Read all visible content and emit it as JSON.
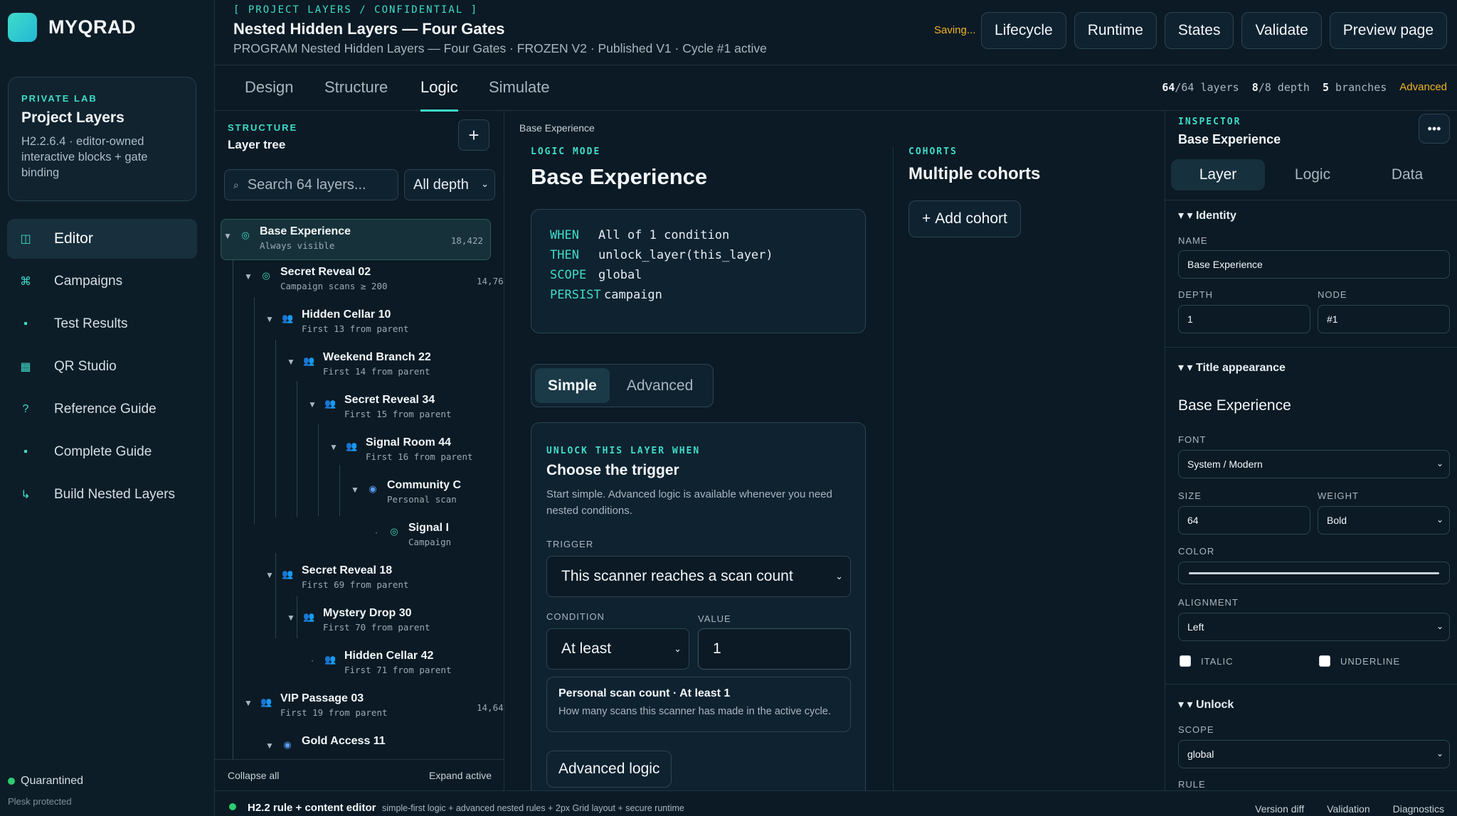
{
  "brand": {
    "name": "MYQRAD"
  },
  "lab": {
    "kicker": "PRIVATE LAB",
    "title": "Project Layers",
    "desc": "H2.2.6.4 · editor-owned interactive blocks + gate binding"
  },
  "nav": [
    {
      "label": "Editor",
      "icon": "layout-icon",
      "glyph": "◫"
    },
    {
      "label": "Campaigns",
      "icon": "command-icon",
      "glyph": "⌘"
    },
    {
      "label": "Test Results",
      "icon": "chart-icon",
      "glyph": "▪"
    },
    {
      "label": "QR Studio",
      "icon": "qr-icon",
      "glyph": "▦"
    },
    {
      "label": "Reference Guide",
      "icon": "help-icon",
      "glyph": "?"
    },
    {
      "label": "Complete Guide",
      "icon": "book-icon",
      "glyph": "▪"
    },
    {
      "label": "Build Nested Layers",
      "icon": "return-arrow-icon",
      "glyph": "↳"
    }
  ],
  "status": {
    "label": "Quarantined",
    "sub": "Plesk protected"
  },
  "header": {
    "kicker": "[ PROJECT LAYERS / CONFIDENTIAL ]",
    "title": "Nested Hidden Layers — Four Gates",
    "subtitle": "PROGRAM Nested Hidden Layers — Four Gates · FROZEN V2 · Published V1 · Cycle #1 active",
    "saving": "Saving...",
    "buttons": [
      "Lifecycle",
      "Runtime",
      "States",
      "Validate",
      "Preview page"
    ]
  },
  "tabs": [
    "Design",
    "Structure",
    "Logic",
    "Simulate"
  ],
  "stats": {
    "layers_a": "64",
    "layers_b": "/64 layers",
    "depth_a": "8",
    "depth_b": "/8 depth",
    "branches_a": "5",
    "branches_b": " branches",
    "mode": "Advanced"
  },
  "tree": {
    "kicker": "STRUCTURE",
    "title": "Layer tree",
    "add": "+",
    "search_placeholder": "Search 64 layers...",
    "depth_filter": "All depth",
    "nodes": [
      {
        "name": "Base Experience",
        "sub": "Always visible",
        "count": "18,422",
        "icon": "target-icon",
        "glyph": "◎",
        "color": "n-teal"
      },
      {
        "name": "Secret Reveal 02",
        "sub": "Campaign scans ≥ 200",
        "count": "14,76",
        "icon": "target-icon",
        "glyph": "◎",
        "color": "n-teal"
      },
      {
        "name": "Hidden Cellar 10",
        "sub": "First 13 from parent",
        "count": "",
        "icon": "users-icon",
        "glyph": "👥",
        "color": "n-grey"
      },
      {
        "name": "Weekend Branch 22",
        "sub": "First 14 from parent",
        "count": "",
        "icon": "users-icon",
        "glyph": "👥",
        "color": "n-grey"
      },
      {
        "name": "Secret Reveal 34",
        "sub": "First 15 from parent",
        "count": "",
        "icon": "users-icon",
        "glyph": "👥",
        "color": "n-grey"
      },
      {
        "name": "Signal Room 44",
        "sub": "First 16 from parent",
        "count": "",
        "icon": "users-icon",
        "glyph": "👥",
        "color": "n-grey"
      },
      {
        "name": "Community C",
        "sub": "Personal scan",
        "count": "",
        "icon": "radio-icon",
        "glyph": "◉",
        "color": "n-blue"
      },
      {
        "name": "Signal I",
        "sub": "Campaign",
        "count": "",
        "icon": "target-icon",
        "glyph": "◎",
        "color": "n-teal"
      },
      {
        "name": "Secret Reveal 18",
        "sub": "First 69 from parent",
        "count": "",
        "icon": "users-icon",
        "glyph": "👥",
        "color": "n-grey"
      },
      {
        "name": "Mystery Drop 30",
        "sub": "First 70 from parent",
        "count": "",
        "icon": "users-icon",
        "glyph": "👥",
        "color": "n-grey"
      },
      {
        "name": "Hidden Cellar 42",
        "sub": "First 71 from parent",
        "count": "",
        "icon": "users-icon",
        "glyph": "👥",
        "color": "n-grey"
      },
      {
        "name": "VIP Passage 03",
        "sub": "First 19 from parent",
        "count": "14,64",
        "icon": "users-icon",
        "glyph": "👥",
        "color": "n-grey"
      },
      {
        "name": "Gold Access 11",
        "sub": "",
        "count": "",
        "icon": "radio-icon",
        "glyph": "◉",
        "color": "n-blue"
      }
    ],
    "collapse": "Collapse all",
    "expand": "Expand active"
  },
  "center": {
    "breadcrumb": "Base Experience",
    "kicker": "LOGIC MODE",
    "title": "Base Experience",
    "code": [
      {
        "kw": "WHEN",
        "val": "All of 1 condition"
      },
      {
        "kw": "THEN",
        "val": "unlock_layer(this_layer)"
      },
      {
        "kw": "SCOPE",
        "val": "global"
      },
      {
        "kw": "PERSIST",
        "val": "campaign"
      }
    ],
    "modes": [
      "Simple",
      "Advanced"
    ],
    "trigger": {
      "kicker": "UNLOCK THIS LAYER WHEN",
      "title": "Choose the trigger",
      "desc": "Start simple. Advanced logic is available whenever you need nested conditions.",
      "trigger_label": "TRIGGER",
      "trigger_value": "This scanner reaches a scan count",
      "condition_label": "CONDITION",
      "condition_value": "At least",
      "value_label": "VALUE",
      "value_value": "1",
      "note_title": "Personal scan count · At least 1",
      "note_desc": "How many scans this scanner has made in the active cycle.",
      "advanced_button": "Advanced logic"
    },
    "cohorts": {
      "kicker": "COHORTS",
      "title": "Multiple cohorts",
      "button": "Add cohort"
    }
  },
  "inspector": {
    "kicker": "INSPECTOR",
    "title": "Base Experience",
    "tabs": [
      "Layer",
      "Logic",
      "Data"
    ],
    "identity": {
      "section": "Identity",
      "name_label": "NAME",
      "name": "Base Experience",
      "depth_label": "DEPTH",
      "depth": "1",
      "node_label": "NODE",
      "node": "#1"
    },
    "title_appearance": {
      "section": "Title appearance",
      "preview": "Base Experience",
      "font_label": "FONT",
      "font": "System / Modern",
      "size_label": "SIZE",
      "size": "64",
      "weight_label": "WEIGHT",
      "weight": "Bold",
      "color_label": "COLOR",
      "align_label": "ALIGNMENT",
      "align": "Left",
      "italic": "ITALIC",
      "underline": "UNDERLINE"
    },
    "unlock": {
      "section": "Unlock",
      "scope_label": "SCOPE",
      "scope": "global",
      "rule_label": "RULE"
    }
  },
  "footer": {
    "title": "H2.2 rule + content editor",
    "desc": "simple-first logic + advanced nested rules + 2px Grid layout + secure runtime",
    "links": [
      "Version diff",
      "Validation",
      "Diagnostics"
    ]
  }
}
